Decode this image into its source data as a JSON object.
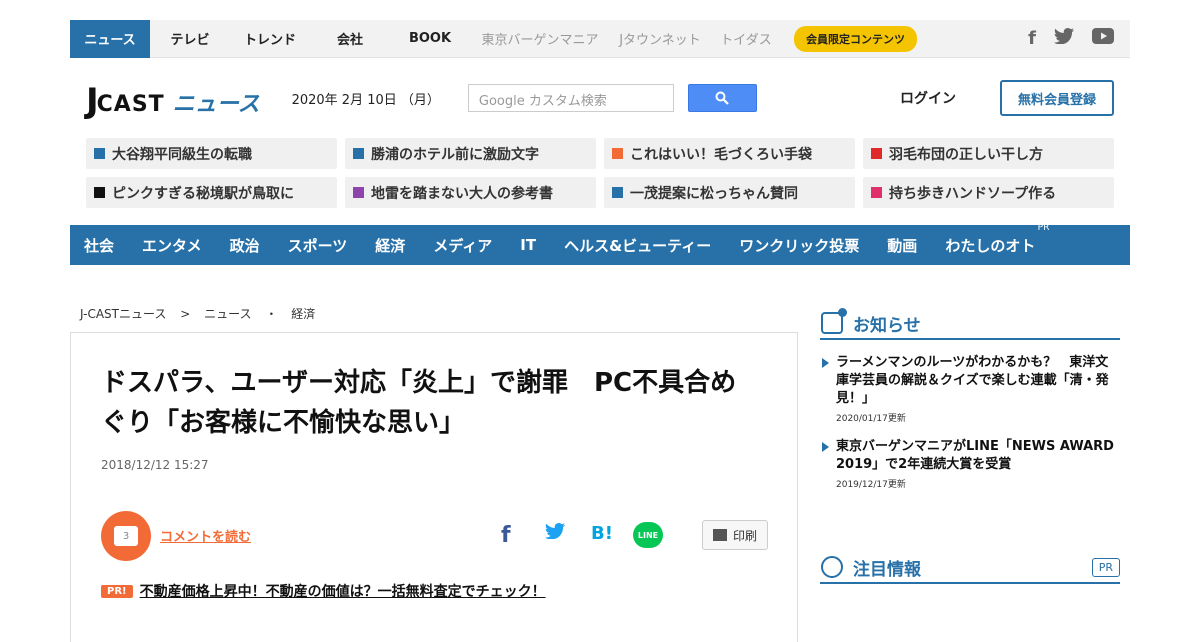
{
  "topnav": {
    "tabs": [
      {
        "label": "ニュース",
        "active": true
      },
      {
        "label": "テレビ"
      },
      {
        "label": "トレンド"
      },
      {
        "label": "会社"
      },
      {
        "label": "BOOK"
      },
      {
        "label": "東京バーゲンマニア",
        "light": true
      },
      {
        "label": "Jタウンネット",
        "light": true
      },
      {
        "label": "トイダス",
        "light": true
      }
    ],
    "member_label": "会員限定コンテンツ",
    "social_icons": [
      "facebook-icon",
      "twitter-icon",
      "youtube-icon"
    ]
  },
  "header": {
    "logo_j": "J",
    "logo_cast": "CAST",
    "logo_news": "ニュース",
    "date": "2020年 2月 10日 （月）",
    "search_placeholder": "Google カスタム検索",
    "login_label": "ログイン",
    "register_label": "無料会員登録"
  },
  "trends": [
    {
      "label": "大谷翔平同級生の転職",
      "color": "#2771a8"
    },
    {
      "label": "勝浦のホテル前に激励文字",
      "color": "#2771a8"
    },
    {
      "label": "これはいい！毛づくろい手袋",
      "color": "#f26b36"
    },
    {
      "label": "羽毛布団の正しい干し方",
      "color": "#e02a2a"
    },
    {
      "label": "ピンクすぎる秘境駅が鳥取に",
      "color": "#111111"
    },
    {
      "label": "地雷を踏まない大人の参考書",
      "color": "#8e44ad"
    },
    {
      "label": "一茂提案に松っちゃん賛同",
      "color": "#2771a8"
    },
    {
      "label": "持ち歩きハンドソープ作る",
      "color": "#e0306a"
    }
  ],
  "categories": [
    "社会",
    "エンタメ",
    "政治",
    "スポーツ",
    "経済",
    "メディア",
    "IT",
    "ヘルス&ビューティー",
    "ワンクリック投票",
    "動画",
    "わたしのオト"
  ],
  "categories_pr": "PR",
  "breadcrumb": {
    "items": [
      "J-CASTニュース",
      "ニュース",
      "経済"
    ],
    "sep1": ">",
    "sep2": "・"
  },
  "article": {
    "title": "ドスパラ、ユーザー対応「炎上」で謝罪　PC不具合めぐり「お客様に不愉快な思い」",
    "date": "2018/12/12 15:27",
    "comment_count": "3",
    "comment_label": "コメントを読む",
    "share": {
      "fb": "f",
      "hb": "B!",
      "line": "LINE"
    },
    "print_label": "印刷",
    "ad_tag": "PR!",
    "ad_text": "不動産価格上昇中！不動産の価値は？一括無料査定でチェック！"
  },
  "sidebar": {
    "notice_title": "お知らせ",
    "notices": [
      {
        "text": "ラーメンマンのルーツがわかるかも？　東洋文庫学芸員の解説＆クイズで楽しむ連載「清・発見！」",
        "date": "2020/01/17更新"
      },
      {
        "text": "東京バーゲンマニアがLINE「NEWS AWARD 2019」で2年連続大賞を受賞",
        "date": "2019/12/17更新"
      }
    ],
    "attention_title": "注目情報",
    "attention_pr": "PR"
  }
}
